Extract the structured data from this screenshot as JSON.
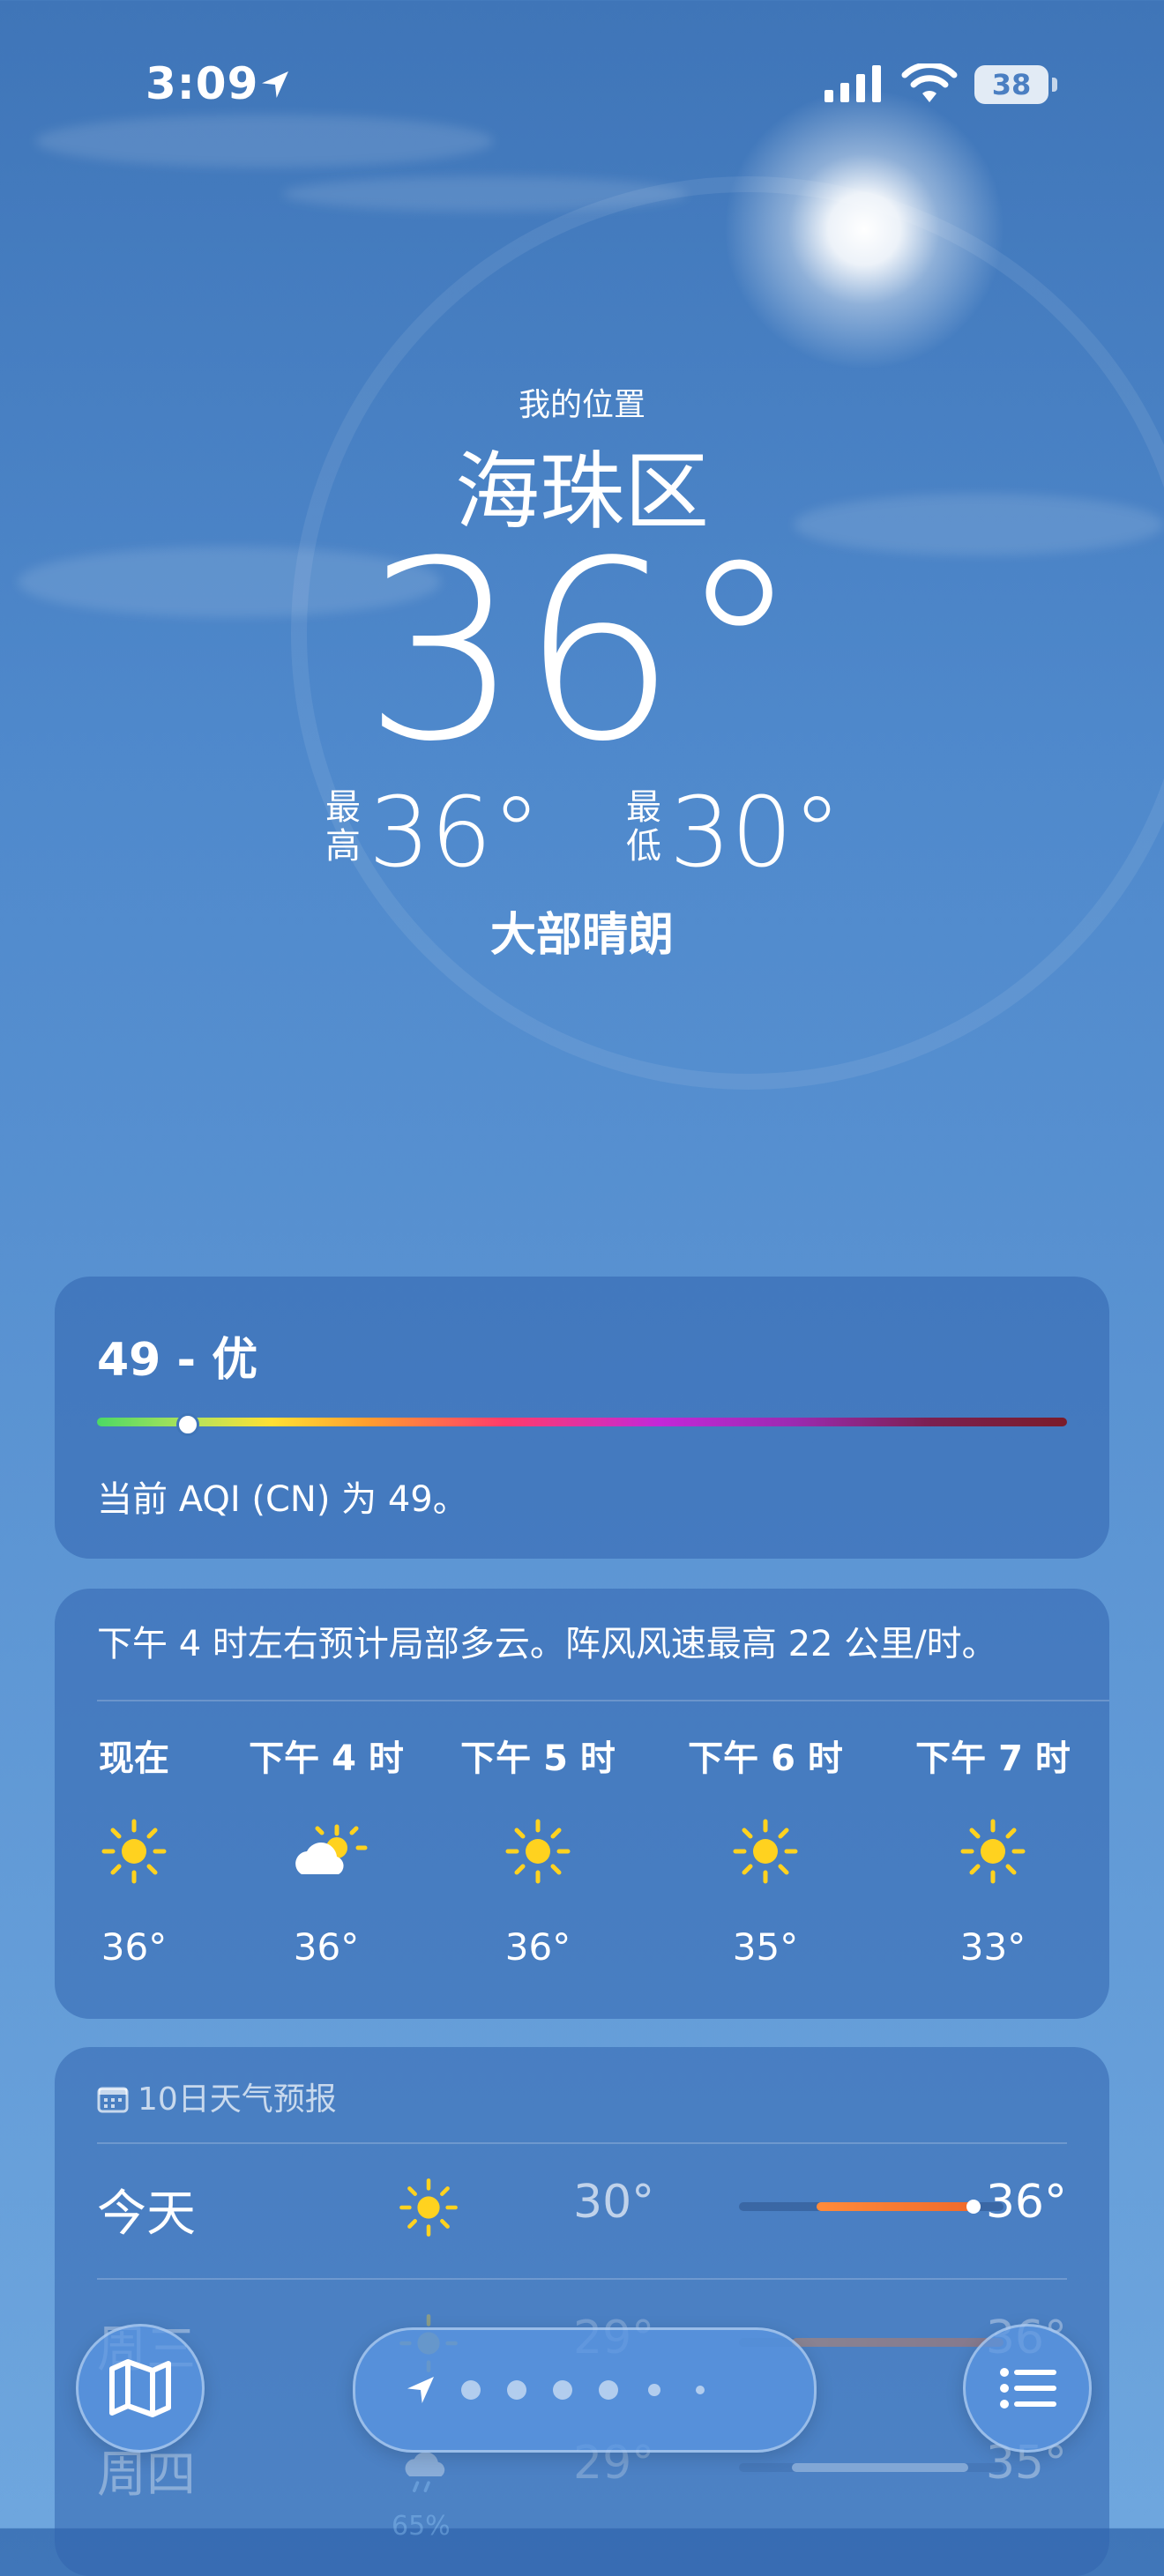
{
  "status_bar": {
    "time": "3:09",
    "battery": "38"
  },
  "header": {
    "location_caption": "我的位置",
    "city": "海珠区",
    "current_temp": "36°",
    "high_label": "最高",
    "high": "36°",
    "low_label": "最低",
    "low": "30°",
    "condition": "大部晴朗"
  },
  "aqi": {
    "title": "49 - 优",
    "value": 49,
    "scale_max": 500,
    "description": "当前 AQI (CN) 为 49。"
  },
  "hourly": {
    "summary": "下午 4 时左右预计局部多云。阵风风速最高 22 公里/时。",
    "items": [
      {
        "label": "现在",
        "icon": "sun-icon",
        "temp": "36°"
      },
      {
        "label": "下午 4 时",
        "icon": "partly-cloudy-icon",
        "temp": "36°"
      },
      {
        "label": "下午 5 时",
        "icon": "sun-icon",
        "temp": "36°"
      },
      {
        "label": "下午 6 时",
        "icon": "sun-icon",
        "temp": "35°"
      },
      {
        "label": "下午 7 时",
        "icon": "sun-icon",
        "temp": "33°"
      }
    ]
  },
  "daily": {
    "header": "10日天气预报",
    "rows": [
      {
        "day": "今天",
        "icon": "sun-icon",
        "low": "30°",
        "high": "36°",
        "pop": ""
      },
      {
        "day": "周三",
        "icon": "sun-icon",
        "low": "29°",
        "high": "36°",
        "pop": ""
      },
      {
        "day": "周四",
        "icon": "rain-cloud-icon",
        "low": "29°",
        "high": "35°",
        "pop": "65%"
      }
    ]
  },
  "toolbar": {
    "page_count": 7,
    "active_page": 0
  },
  "colors": {
    "accent_orange": "#f06a2a",
    "sun_yellow": "#ffd21f",
    "bg_blue": "#4f89cc"
  }
}
